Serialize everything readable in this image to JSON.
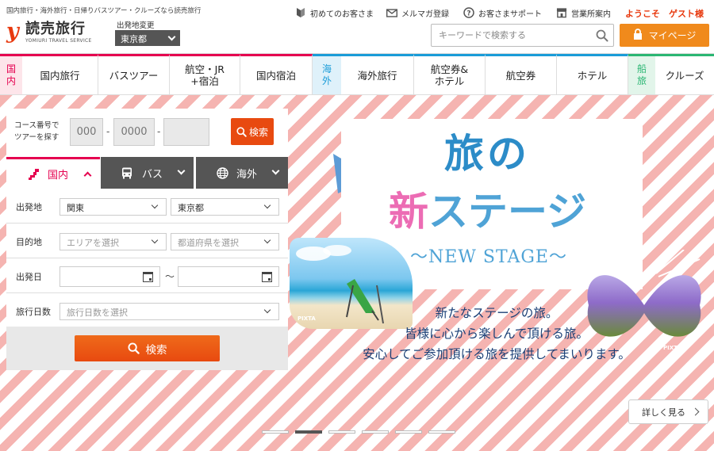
{
  "header": {
    "tagline": "国内旅行・海外旅行・日帰りバスツアー・クルーズなら読売旅行",
    "logo_mark": "y",
    "logo_text": "読売旅行",
    "logo_sub": "YOMIURI TRAVEL SERVICE",
    "departure_label": "出発地変更",
    "departure_value": "東京都",
    "links": {
      "first_time": "初めてのお客さま",
      "newsletter": "メルマガ登録",
      "support": "お客さまサポート",
      "offices": "営業所案内"
    },
    "welcome": "ようこそ　ゲスト様",
    "search_placeholder": "キーワードで検索する",
    "mypage_label": "マイページ"
  },
  "nav": {
    "domestic_label": "国内",
    "overseas_label": "海外",
    "cruise_label": "船旅",
    "items": [
      "国内旅行",
      "バスツアー",
      "航空・JR\n+宿泊",
      "国内宿泊",
      "海外旅行",
      "航空券&\nホテル",
      "航空券",
      "ホテル",
      "クルーズ"
    ]
  },
  "panel": {
    "course_label_1": "コース番号で",
    "course_label_2": "ツアーを探す",
    "course_placeholders": [
      "000",
      "0000",
      ""
    ],
    "course_search": "検索",
    "tabs": {
      "domestic": "国内",
      "bus": "バス",
      "overseas": "海外"
    },
    "rows": {
      "departure": "出発地",
      "departure_region": "関東",
      "departure_pref": "東京都",
      "destination": "目的地",
      "area_placeholder": "エリアを選択",
      "pref_placeholder": "都道府県を選択",
      "date": "出発日",
      "date_tilde": "〜",
      "days": "旅行日数",
      "days_placeholder": "旅行日数を選択"
    },
    "search_button": "検索"
  },
  "hero": {
    "title_line1": "旅の",
    "title_new": "新",
    "title_rest": "ステージ",
    "subtitle": "～NEW STAGE～",
    "desc": [
      "新たなステージの旅。",
      "皆様に心から楽しんで頂ける旅。",
      "安心してご参加頂ける旅を提供してまいります。"
    ],
    "pixta": "PIXTA",
    "more_label": "詳しく見る",
    "slide_count": 6,
    "active_slide": 2
  },
  "colors": {
    "brand_orange": "#f08a1c",
    "search_orange": "#e84a10",
    "domestic": "#e5004f",
    "overseas": "#1a9cd8",
    "cruise": "#2bb673",
    "stripe": "#f5b4b1"
  }
}
